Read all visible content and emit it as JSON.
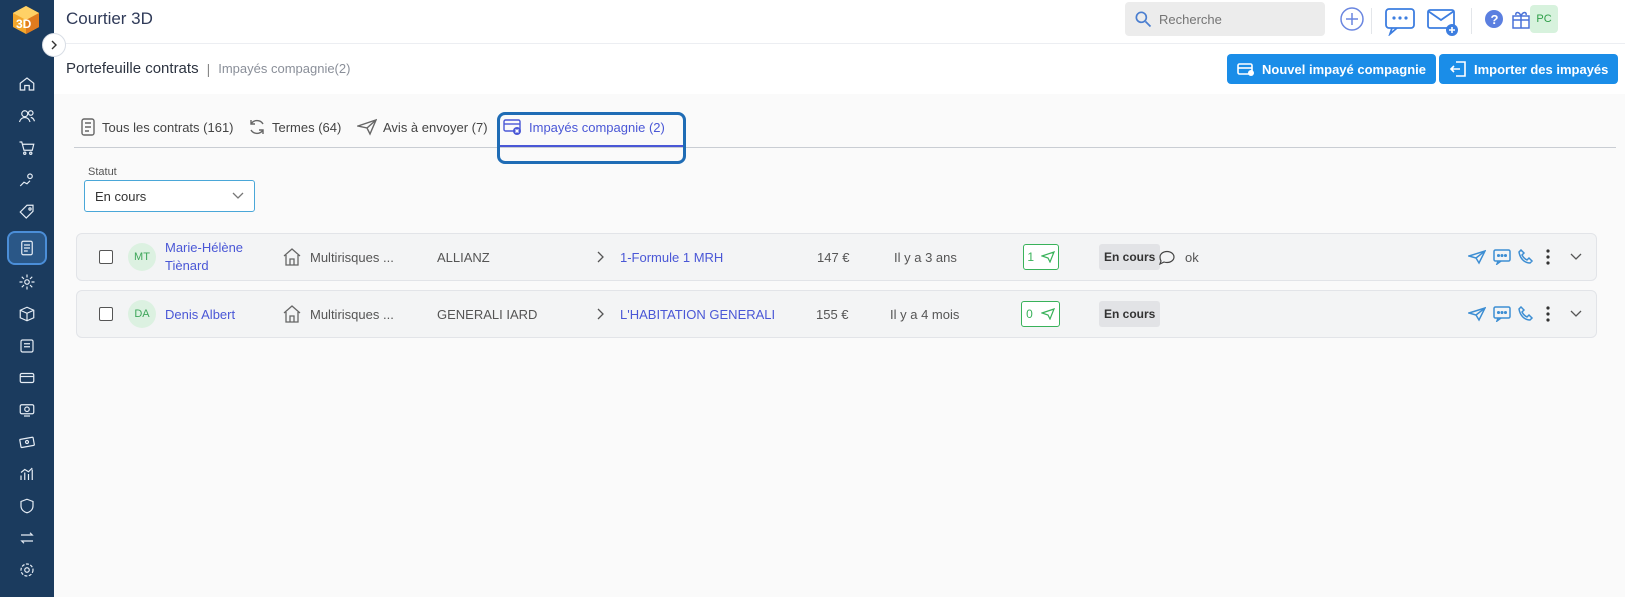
{
  "app": {
    "title": "Courtier 3D",
    "logo_text": "3D"
  },
  "search": {
    "placeholder": "Recherche"
  },
  "user": {
    "initials": "PC"
  },
  "breadcrumb": {
    "main": "Portefeuille contrats",
    "separator": "|",
    "sub": "Impayés compagnie(2)"
  },
  "actions": {
    "new_unpaid": "Nouvel impayé compagnie",
    "import_unpaid": "Importer des impayés"
  },
  "tabs": [
    {
      "label": "Tous les contrats (161)",
      "icon": "contract-icon"
    },
    {
      "label": "Termes (64)",
      "icon": "refresh-icon"
    },
    {
      "label": "Avis à envoyer (7)",
      "icon": "send-icon"
    },
    {
      "label": "Impayés compagnie (2)",
      "icon": "card-error-icon",
      "active": true
    }
  ],
  "filter": {
    "label": "Statut",
    "value": "En cours"
  },
  "rows": [
    {
      "initials": "MT",
      "name": "Marie-Hélène Tiènard",
      "product": "Multirisques ...",
      "company": "ALLIANZ",
      "formula": "1-Formule 1 MRH",
      "amount": "147 €",
      "age": "Il y a 3 ans",
      "count": "1",
      "status": "En cours",
      "comment": "ok"
    },
    {
      "initials": "DA",
      "name": "Denis Albert",
      "product": "Multirisques ...",
      "company": "GENERALI IARD",
      "formula": "L'HABITATION GENERALI",
      "amount": "155 €",
      "age": "Il y a 4 mois",
      "count": "0",
      "status": "En cours",
      "comment": ""
    }
  ],
  "colors": {
    "sidebar": "#1b3b5e",
    "primary": "#1a8de8",
    "link": "#4a57d6",
    "success": "#39b25a"
  }
}
